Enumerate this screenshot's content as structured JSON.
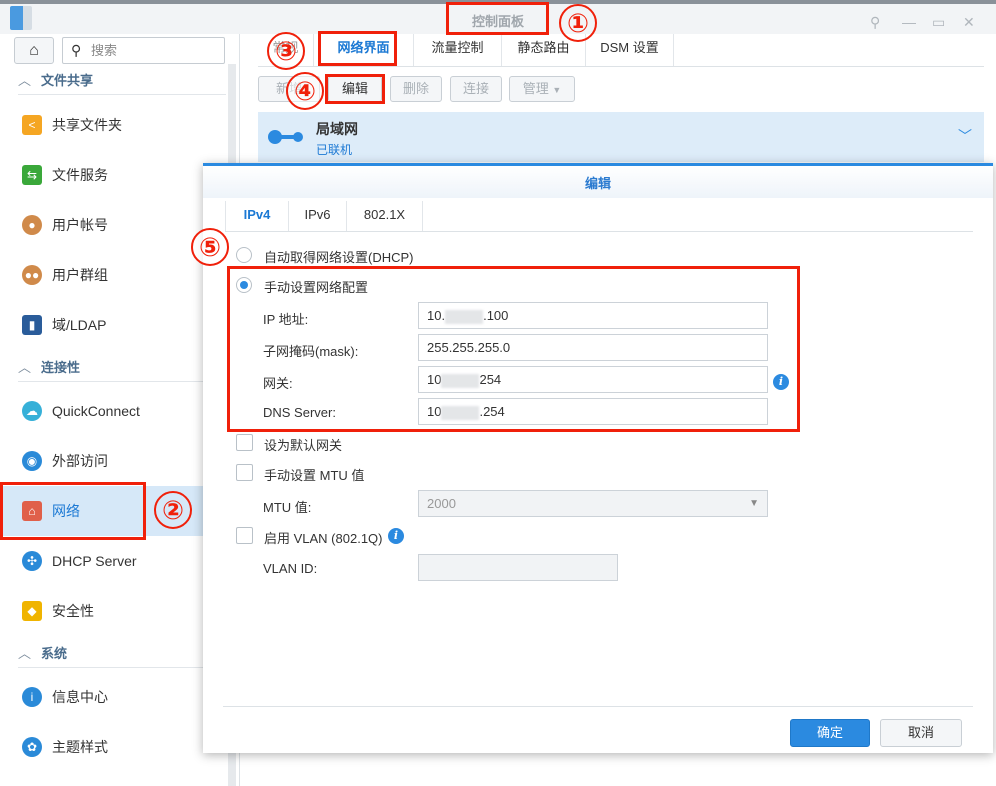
{
  "window": {
    "title": "控制面板",
    "controls": [
      "pin",
      "minimize",
      "maximize",
      "close"
    ]
  },
  "sidebar": {
    "search_placeholder": "搜索",
    "sections": [
      {
        "label": "文件共享",
        "items": [
          {
            "label": "共享文件夹",
            "icon": "shared-folder-icon",
            "color": "#f5a623"
          },
          {
            "label": "文件服务",
            "icon": "file-services-icon",
            "color": "#3aa83a"
          },
          {
            "label": "用户帐号",
            "icon": "user-icon",
            "color": "#d08a4a"
          },
          {
            "label": "用户群组",
            "icon": "group-icon",
            "color": "#d08a4a"
          },
          {
            "label": "域/LDAP",
            "icon": "ldap-icon",
            "color": "#2a5c9a"
          }
        ]
      },
      {
        "label": "连接性",
        "items": [
          {
            "label": "QuickConnect",
            "icon": "quickconnect-icon",
            "color": "#36b0d8"
          },
          {
            "label": "外部访问",
            "icon": "external-access-icon",
            "color": "#2a8ad8"
          },
          {
            "label": "网络",
            "icon": "network-icon",
            "color": "#e0604a",
            "selected": true
          },
          {
            "label": "DHCP Server",
            "icon": "dhcp-icon",
            "color": "#2a8ad8"
          },
          {
            "label": "安全性",
            "icon": "security-icon",
            "color": "#f0b400"
          }
        ]
      },
      {
        "label": "系统",
        "items": [
          {
            "label": "信息中心",
            "icon": "info-center-icon",
            "color": "#2a8ad8"
          },
          {
            "label": "主题样式",
            "icon": "theme-icon",
            "color": "#2a8ad8"
          }
        ]
      }
    ]
  },
  "tabs": [
    "常规",
    "网络界面",
    "流量控制",
    "静态路由",
    "DSM 设置"
  ],
  "toolbar": {
    "new": "新增",
    "edit": "编辑",
    "delete": "删除",
    "connect": "连接",
    "manage": "管理"
  },
  "interface": {
    "name": "局域网",
    "status": "已联机"
  },
  "dialog": {
    "title": "编辑",
    "tabs": [
      "IPv4",
      "IPv6",
      "802.1X"
    ],
    "dhcp_label": "自动取得网络设置(DHCP)",
    "manual_label": "手动设置网络配置",
    "fields": [
      {
        "label": "IP 地址:",
        "prefix": "10.",
        "suffix": ".100"
      },
      {
        "label": "子网掩码(mask):",
        "prefix": "255.255.255.0",
        "suffix": ""
      },
      {
        "label": "网关:",
        "prefix": "10",
        "suffix": "254"
      },
      {
        "label": "DNS Server:",
        "prefix": "10",
        "suffix": ".254"
      }
    ],
    "default_gateway_label": "设为默认网关",
    "mtu_check_label": "手动设置 MTU 值",
    "mtu_label": "MTU 值:",
    "mtu_value": "2000",
    "vlan_check_label": "启用 VLAN (802.1Q)",
    "vlan_id_label": "VLAN ID:",
    "ok": "确定",
    "cancel": "取消"
  },
  "annotations": [
    "①",
    "②",
    "③",
    "④",
    "⑤"
  ],
  "colors": {
    "accent": "#2b8ae0",
    "annotation": "#f0200a"
  }
}
